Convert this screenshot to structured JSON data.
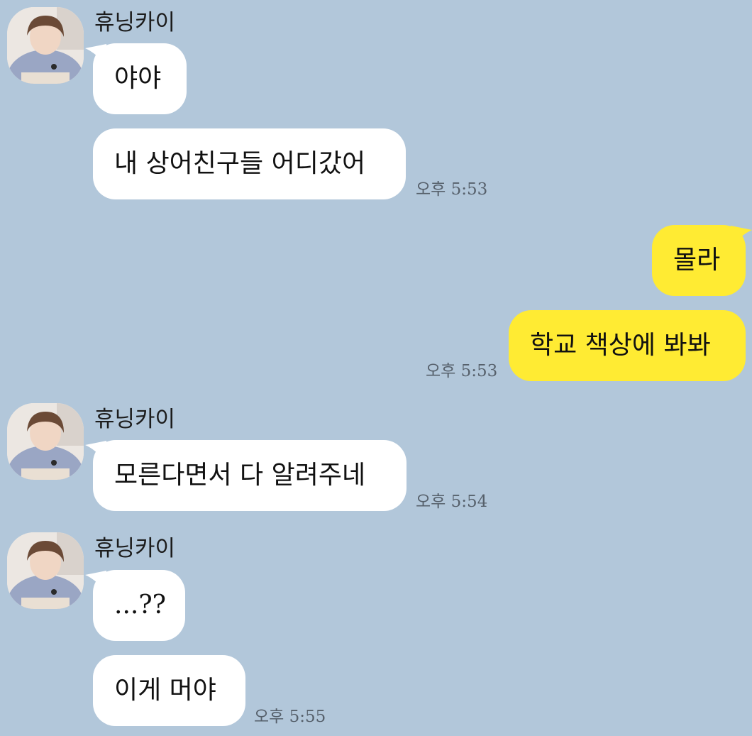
{
  "colors": {
    "background": "#b2c7da",
    "incoming": "#ffffff",
    "outgoing": "#ffeb33",
    "time": "#56606b"
  },
  "messages": [
    {
      "sender": "휴닝카이",
      "bubbles": [
        "야야",
        "내 상어친구들 어디갔어"
      ],
      "time": "오후 5:53"
    },
    {
      "bubbles": [
        "몰라",
        "학교 책상에 봐봐"
      ],
      "time": "오후 5:53"
    },
    {
      "sender": "휴닝카이",
      "bubbles": [
        "모른다면서 다 알려주네"
      ],
      "time": "오후 5:54"
    },
    {
      "sender": "휴닝카이",
      "bubbles": [
        "...??",
        "이게 머야"
      ],
      "time": "오후 5:55"
    }
  ]
}
